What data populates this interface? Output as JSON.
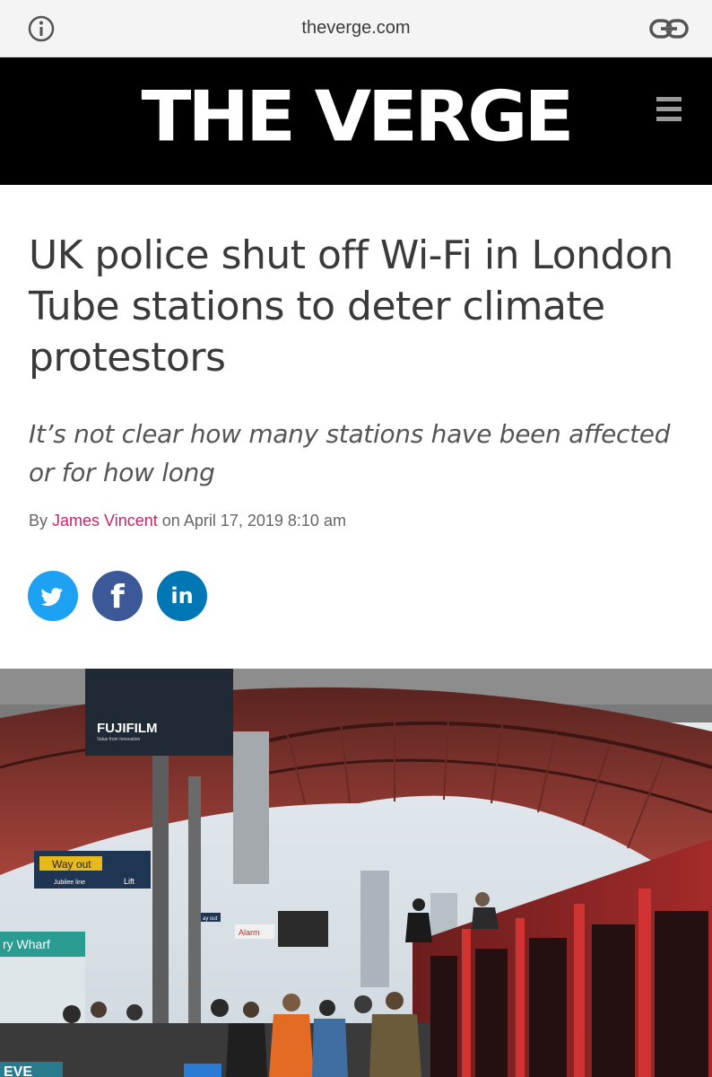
{
  "browser": {
    "url": "theverge.com",
    "info_icon": "info-circle-icon",
    "share_link_icon": "link-icon"
  },
  "masthead": {
    "logo_text": "THE VERGE",
    "menu_icon": "hamburger-menu-icon",
    "background": "#000000"
  },
  "article": {
    "headline": "UK police shut off Wi-Fi in London Tube stations to deter climate protestors",
    "dek": "It’s not clear how many stations have been affected or for how long",
    "byline_prefix": "By",
    "author": "James Vincent",
    "byline_on": "on",
    "date": "April 17, 2019 8:10 am",
    "author_color": "#c4266c"
  },
  "share": {
    "twitter_icon": "twitter-icon",
    "facebook_label": "f",
    "linkedin_label": "in",
    "colors": {
      "twitter": "#1da1f2",
      "facebook": "#3b5998",
      "linkedin": "#0077b5"
    }
  },
  "photo": {
    "billboard_text": "FUJIFILM",
    "billboard_sub": "Value from Innovation",
    "sign_way_out": "Way out",
    "sign_jubilee": "Jubilee line",
    "sign_lift": "Lift",
    "sign_station": "ry Wharf",
    "sign_alarm": "Alarm",
    "sign_wayout_small": "ay out",
    "sign_eve": "EVE"
  }
}
